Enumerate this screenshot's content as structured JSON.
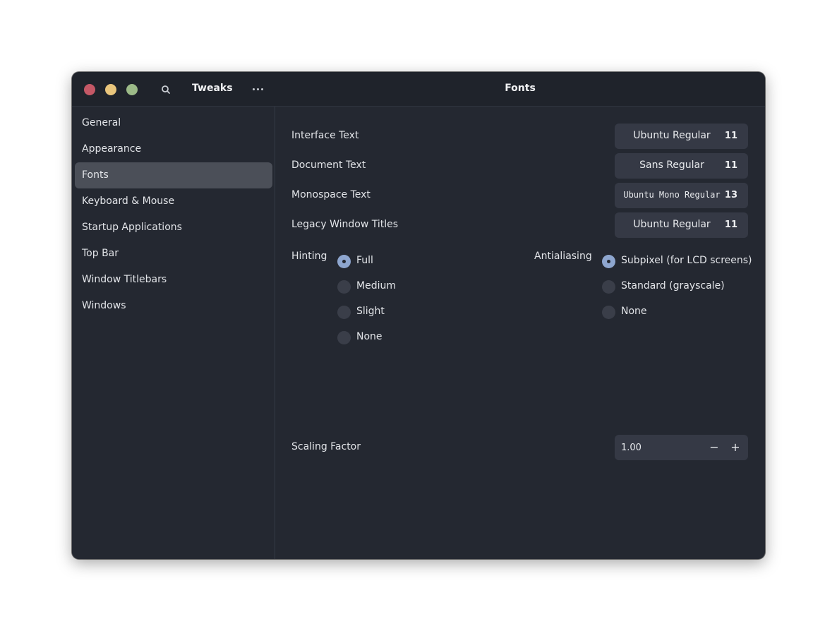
{
  "header": {
    "app_title": "Tweaks",
    "page_title": "Fonts"
  },
  "sidebar": {
    "items": [
      {
        "label": "General"
      },
      {
        "label": "Appearance"
      },
      {
        "label": "Fonts",
        "active": true
      },
      {
        "label": "Keyboard & Mouse"
      },
      {
        "label": "Startup Applications"
      },
      {
        "label": "Top Bar"
      },
      {
        "label": "Window Titlebars"
      },
      {
        "label": "Windows"
      }
    ]
  },
  "fonts": {
    "interface_text": {
      "label": "Interface Text",
      "font": "Ubuntu Regular",
      "size": "11"
    },
    "document_text": {
      "label": "Document Text",
      "font": "Sans Regular",
      "size": "11"
    },
    "monospace_text": {
      "label": "Monospace Text",
      "font": "Ubuntu Mono Regular",
      "size": "13"
    },
    "legacy_titles": {
      "label": "Legacy Window Titles",
      "font": "Ubuntu Regular",
      "size": "11"
    }
  },
  "hinting": {
    "label": "Hinting",
    "options": [
      "Full",
      "Medium",
      "Slight",
      "None"
    ],
    "selected": "Full"
  },
  "antialiasing": {
    "label": "Antialiasing",
    "options": [
      "Subpixel (for LCD screens)",
      "Standard (grayscale)",
      "None"
    ],
    "selected": "Subpixel (for LCD screens)"
  },
  "scaling": {
    "label": "Scaling Factor",
    "value": "1.00",
    "minus": "−",
    "plus": "+"
  },
  "icons": {
    "window_close": "close-icon",
    "window_minimize": "minimize-icon",
    "window_maximize": "maximize-icon",
    "search": "search-icon",
    "menu": "more-icon"
  },
  "colors": {
    "accent": "#8ea6cf",
    "window_bg": "#242831",
    "sidebar_active": "#4b4f58",
    "close": "#c45866",
    "minimize": "#e9c57c",
    "maximize": "#9cba88"
  }
}
